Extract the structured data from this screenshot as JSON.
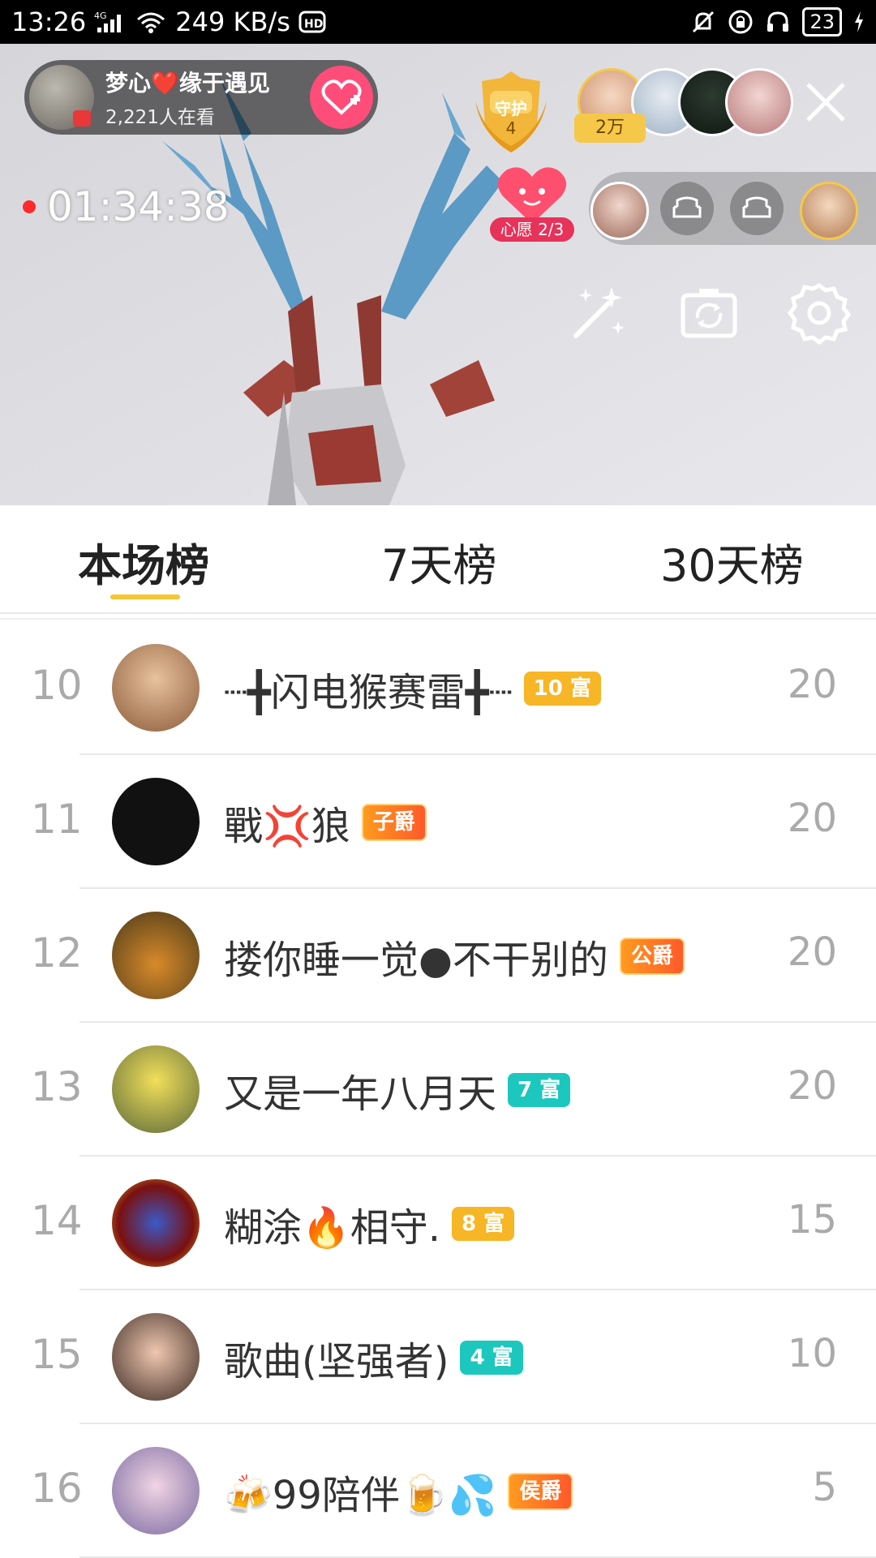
{
  "status_bar": {
    "time": "13:26",
    "network": "4G",
    "speed": "249 KB/s",
    "hd": "HD",
    "battery": "23"
  },
  "live": {
    "host_name": "梦心❤️缘于遇见",
    "viewers": "2,221人在看",
    "guard_label": "守护",
    "guard_count": "4",
    "contribution": "2万",
    "timer": "01:34:38",
    "wish_label": "心愿 2/3"
  },
  "tabs": [
    {
      "label": "本场榜",
      "active": true
    },
    {
      "label": "7天榜",
      "active": false
    },
    {
      "label": "30天榜",
      "active": false
    }
  ],
  "ranking": [
    {
      "rank": "10",
      "name": "┈╋闪电猴赛雷╋┈",
      "badge": "10 富",
      "badge_type": "rich-gold",
      "score": "20",
      "avatar_color": "#c9a27a"
    },
    {
      "rank": "11",
      "name": "戰💢狼",
      "badge": "子爵",
      "badge_type": "noble",
      "score": "20",
      "avatar_color": "#111111"
    },
    {
      "rank": "12",
      "name": "搂你睡一觉●不干别的",
      "badge": "公爵",
      "badge_type": "noble",
      "score": "20",
      "avatar_color": "#8a6a2a"
    },
    {
      "rank": "13",
      "name": "又是一年八月天",
      "badge": "7 富",
      "badge_type": "rich-teal",
      "score": "20",
      "avatar_color": "#c9c25a"
    },
    {
      "rank": "14",
      "name": "糊涂🔥相守.",
      "badge": "8 富",
      "badge_type": "rich-gold",
      "score": "15",
      "avatar_color": "#8b1a1a"
    },
    {
      "rank": "15",
      "name": "歌曲(坚强者)",
      "badge": "4 富",
      "badge_type": "rich-teal",
      "score": "10",
      "avatar_color": "#7a6a60"
    },
    {
      "rank": "16",
      "name": "🍻99陪伴🍺💦",
      "badge": "侯爵",
      "badge_type": "noble",
      "score": "5",
      "avatar_color": "#9a8ab0"
    }
  ]
}
